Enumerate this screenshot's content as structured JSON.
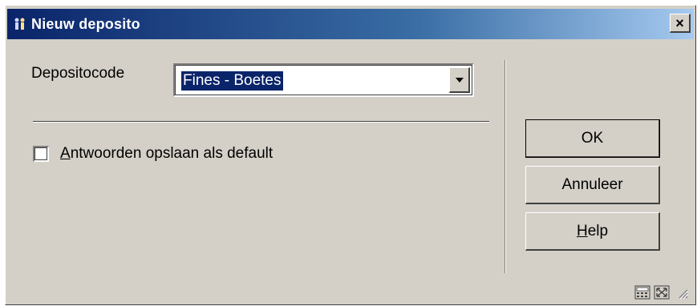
{
  "window": {
    "title": "Nieuw deposito",
    "close_label": "×"
  },
  "form": {
    "depositocode_label": "Depositocode",
    "depositocode_value": "Fines - Boetes",
    "save_default_label_mnemonic": "A",
    "save_default_label_rest": "ntwoorden opslaan als default",
    "save_default_checked": false
  },
  "buttons": {
    "ok": "OK",
    "cancel": "Annuleer",
    "help_mnemonic": "H",
    "help_rest": "elp"
  },
  "icons": [
    "users-icon",
    "calculator-icon",
    "resize-icon",
    "size-grip-icon"
  ]
}
